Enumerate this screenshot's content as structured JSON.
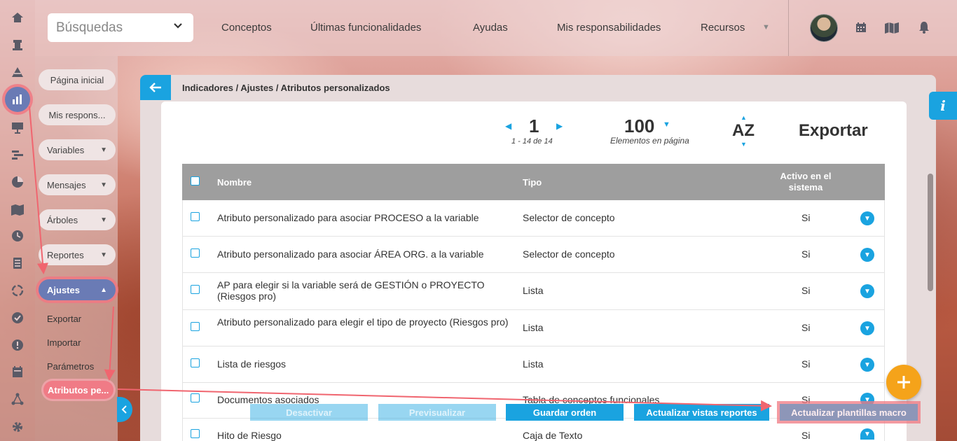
{
  "topbar": {
    "search_label": "Búsquedas",
    "nav": [
      "Conceptos",
      "Últimas funcionalidades",
      "Ayudas",
      "Mis responsabilidades",
      "Recursos"
    ]
  },
  "sidebar": {
    "items": [
      {
        "label": "Página inicial"
      },
      {
        "label": "Mis respons..."
      },
      {
        "label": "Variables"
      },
      {
        "label": "Mensajes"
      },
      {
        "label": "Árboles"
      },
      {
        "label": "Reportes"
      },
      {
        "label": "Ajustes"
      }
    ],
    "subitems": [
      "Exportar",
      "Importar",
      "Parámetros",
      "Atributos pe..."
    ]
  },
  "breadcrumb": "Indicadores / Ajustes / Atributos personalizados",
  "pager": {
    "page": "1",
    "range": "1 - 14 de 14",
    "per_page": "100",
    "per_page_label": "Elementos en página",
    "sort_label": "AZ",
    "export_label": "Exportar"
  },
  "table": {
    "headers": {
      "nombre": "Nombre",
      "tipo": "Tipo",
      "activo": "Activo en el sistema"
    },
    "rows": [
      {
        "nombre": "Atributo personalizado para asociar PROCESO a la variable",
        "tipo": "Selector de concepto",
        "activo": "Si"
      },
      {
        "nombre": "Atributo personalizado para asociar ÁREA ORG. a la variable",
        "tipo": "Selector de concepto",
        "activo": "Si"
      },
      {
        "nombre": "AP para elegir si la variable será de GESTIÓN o PROYECTO (Riesgos pro)",
        "tipo": "Lista",
        "activo": "Si"
      },
      {
        "nombre": "Atributo personalizado para elegir el tipo de proyecto (Riesgos pro)",
        "tipo": "Lista",
        "activo": "Si"
      },
      {
        "nombre": "Lista de riesgos",
        "tipo": "Lista",
        "activo": "Si"
      },
      {
        "nombre": "Documentos asociados",
        "tipo": "Tabla de conceptos funcionales",
        "activo": "Si"
      },
      {
        "nombre": "Hito de Riesgo",
        "tipo": "Caja de Texto",
        "activo": "Si"
      }
    ]
  },
  "actions": {
    "deactivate": "Desactivar",
    "preview": "Previsualizar",
    "save_order": "Guardar orden",
    "update_reports": "Actualizar vistas reportes",
    "update_macros": "Actualizar plantillas macro"
  },
  "colors": {
    "accent": "#1aa3e0",
    "fab": "#f5a31a",
    "highlight": "#f07b86",
    "selected": "#6a7bb5"
  }
}
